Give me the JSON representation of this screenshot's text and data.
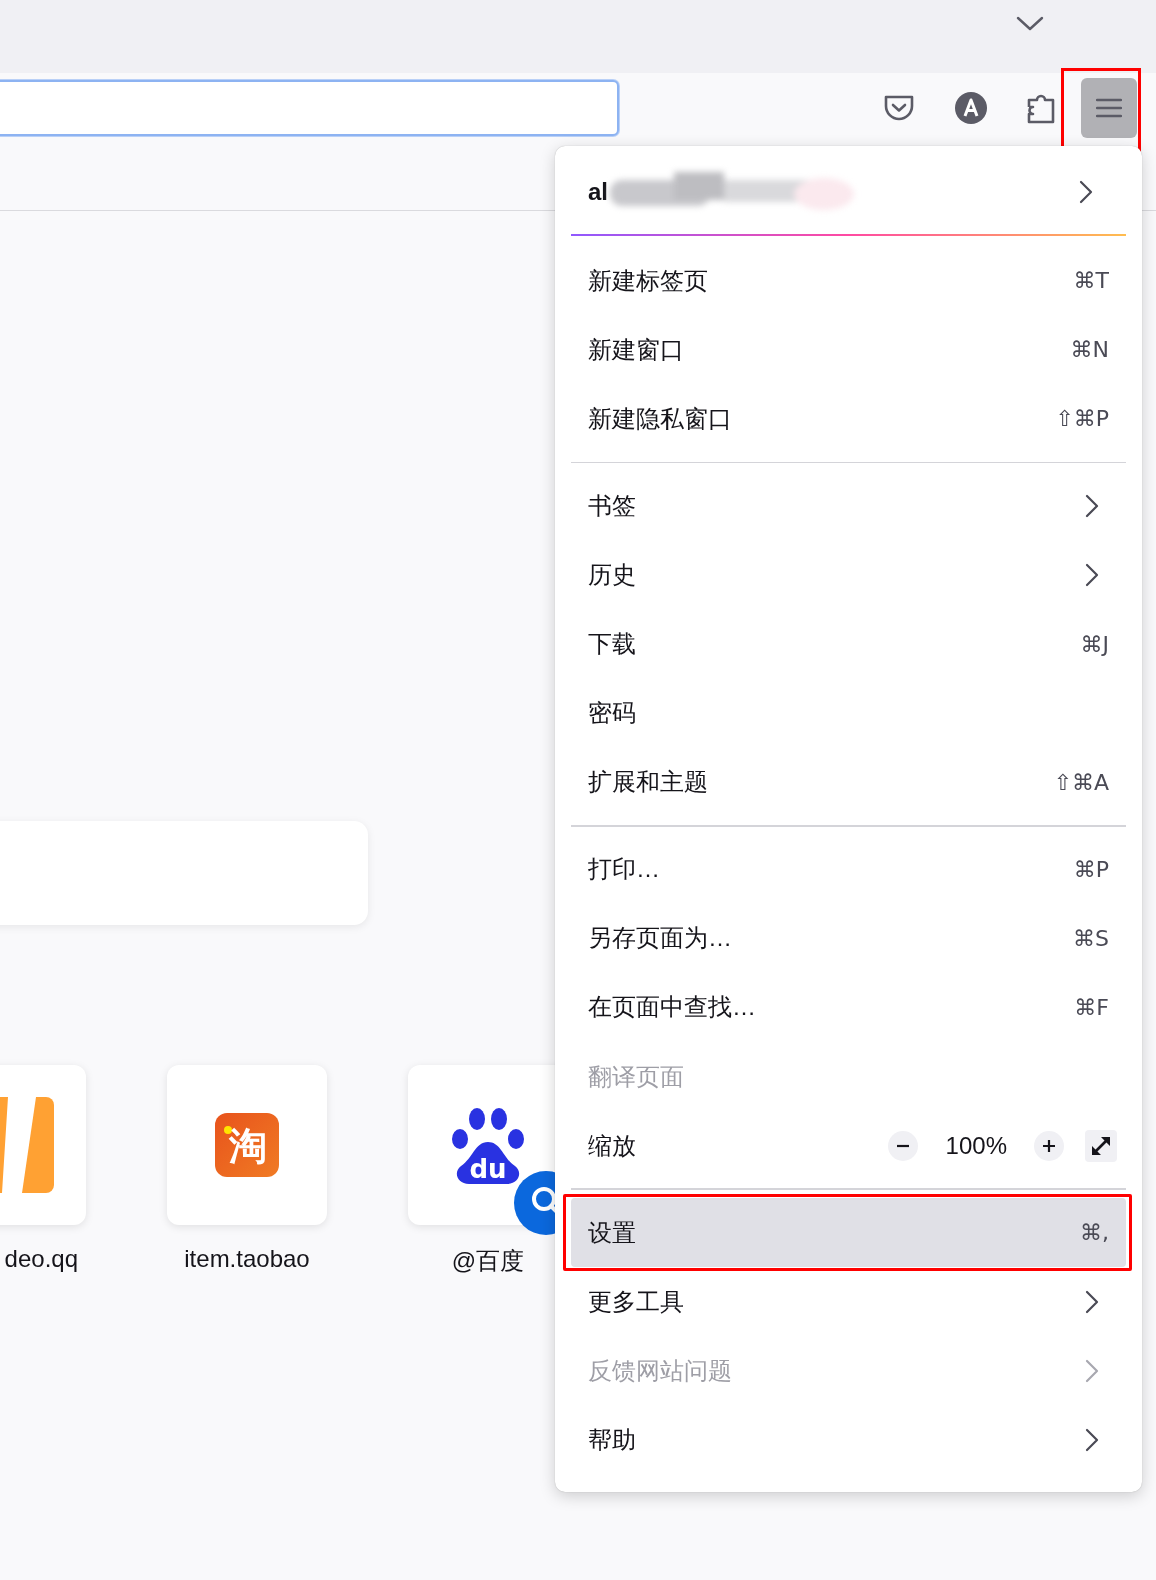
{
  "toolbar": {
    "address_field": {
      "focused": true
    },
    "menu_button": {
      "pressed": true,
      "annotated": true
    }
  },
  "new_tab": {
    "tiles": [
      {
        "label": "deo.qq"
      },
      {
        "label": "item.taobao",
        "logo_text": "淘"
      },
      {
        "label": "@百度",
        "logo_text": "du"
      }
    ]
  },
  "menu": {
    "items": [
      {
        "kind": "account",
        "label": "al"
      },
      {
        "kind": "item",
        "label": "新建标签页",
        "shortcut": "⌘T",
        "submenu": false,
        "disabled": false,
        "selected": false,
        "annotated": false
      },
      {
        "kind": "item",
        "label": "新建窗口",
        "shortcut": "⌘N",
        "submenu": false,
        "disabled": false,
        "selected": false,
        "annotated": false
      },
      {
        "kind": "item",
        "label": "新建隐私窗口",
        "shortcut": "⇧⌘P",
        "submenu": false,
        "disabled": false,
        "selected": false,
        "annotated": false
      },
      {
        "kind": "separator"
      },
      {
        "kind": "item",
        "label": "书签",
        "submenu": true,
        "disabled": false,
        "selected": false,
        "annotated": false
      },
      {
        "kind": "item",
        "label": "历史",
        "submenu": true,
        "disabled": false,
        "selected": false,
        "annotated": false
      },
      {
        "kind": "item",
        "label": "下载",
        "shortcut": "⌘J",
        "submenu": false,
        "disabled": false,
        "selected": false,
        "annotated": false
      },
      {
        "kind": "item",
        "label": "密码",
        "submenu": false,
        "disabled": false,
        "selected": false,
        "annotated": false
      },
      {
        "kind": "item",
        "label": "扩展和主题",
        "shortcut": "⇧⌘A",
        "submenu": false,
        "disabled": false,
        "selected": false,
        "annotated": false
      },
      {
        "kind": "separator"
      },
      {
        "kind": "item",
        "label": "打印…",
        "shortcut": "⌘P",
        "submenu": false,
        "disabled": false,
        "selected": false,
        "annotated": false
      },
      {
        "kind": "item",
        "label": "另存页面为…",
        "shortcut": "⌘S",
        "submenu": false,
        "disabled": false,
        "selected": false,
        "annotated": false
      },
      {
        "kind": "item",
        "label": "在页面中查找…",
        "shortcut": "⌘F",
        "submenu": false,
        "disabled": false,
        "selected": false,
        "annotated": false
      },
      {
        "kind": "item",
        "label": "翻译页面",
        "submenu": false,
        "disabled": true,
        "selected": false,
        "annotated": false
      },
      {
        "kind": "zoom",
        "label": "缩放",
        "value": "100%"
      },
      {
        "kind": "separator"
      },
      {
        "kind": "item",
        "label": "设置",
        "shortcut": "⌘,",
        "submenu": false,
        "disabled": false,
        "selected": true,
        "annotated": true
      },
      {
        "kind": "item",
        "label": "更多工具",
        "submenu": true,
        "disabled": false,
        "selected": false,
        "annotated": false
      },
      {
        "kind": "item",
        "label": "反馈网站问题",
        "submenu": true,
        "disabled": true,
        "selected": false,
        "annotated": false
      },
      {
        "kind": "item",
        "label": "帮助",
        "submenu": true,
        "disabled": false,
        "selected": false,
        "annotated": false
      }
    ]
  }
}
